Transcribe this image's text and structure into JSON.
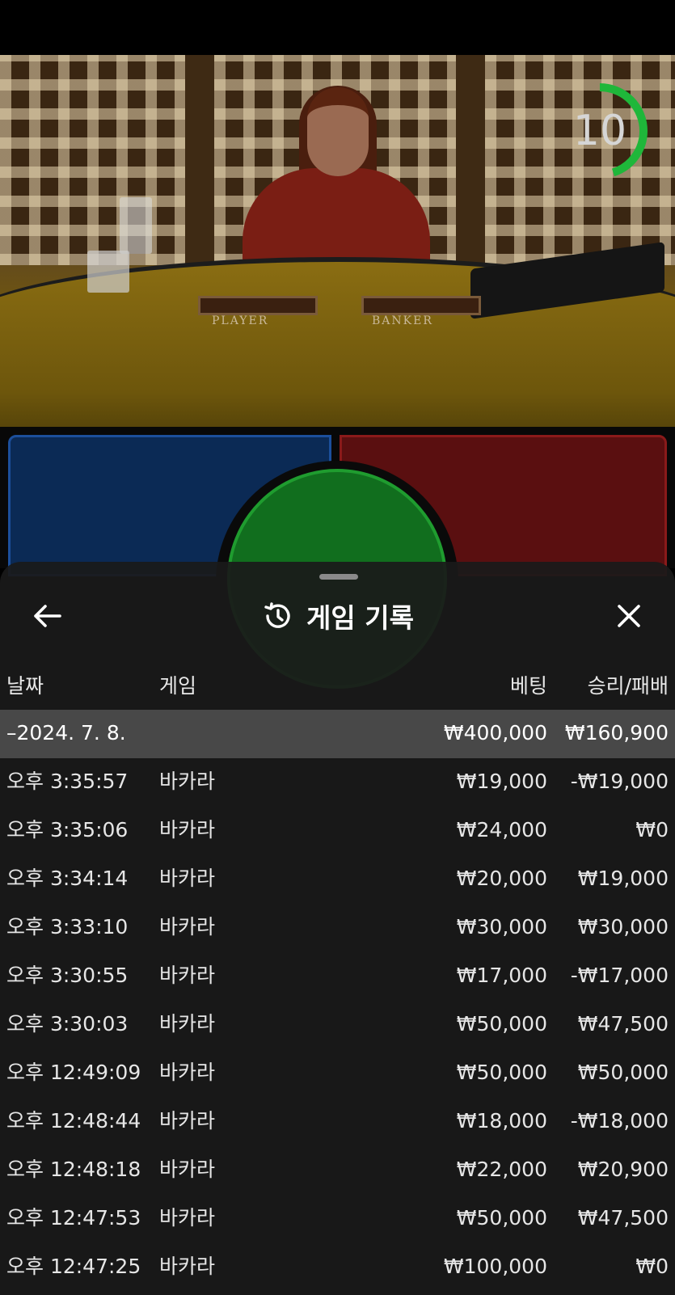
{
  "timer": {
    "value": "10",
    "progress": 0.45,
    "color": "#1fb73a"
  },
  "table": {
    "player_label": "PLAYER",
    "banker_label": "BANKER"
  },
  "sheet": {
    "title": "게임 기록",
    "back_icon": "arrow-left-icon",
    "history_icon": "history-icon",
    "close_icon": "close-icon"
  },
  "columns": {
    "date": "날짜",
    "game": "게임",
    "bet": "베팅",
    "win_loss": "승리/패배"
  },
  "summary": {
    "date": "–2024. 7. 8.",
    "bet": "₩400,000",
    "win_loss": "₩160,900"
  },
  "rows": [
    {
      "time": "오후 3:35:57",
      "game": "바카라",
      "bet": "₩19,000",
      "win_loss": "-₩19,000"
    },
    {
      "time": "오후 3:35:06",
      "game": "바카라",
      "bet": "₩24,000",
      "win_loss": "₩0"
    },
    {
      "time": "오후 3:34:14",
      "game": "바카라",
      "bet": "₩20,000",
      "win_loss": "₩19,000"
    },
    {
      "time": "오후 3:33:10",
      "game": "바카라",
      "bet": "₩30,000",
      "win_loss": "₩30,000"
    },
    {
      "time": "오후 3:30:55",
      "game": "바카라",
      "bet": "₩17,000",
      "win_loss": "-₩17,000"
    },
    {
      "time": "오후 3:30:03",
      "game": "바카라",
      "bet": "₩50,000",
      "win_loss": "₩47,500"
    },
    {
      "time": "오후 12:49:09",
      "game": "바카라",
      "bet": "₩50,000",
      "win_loss": "₩50,000"
    },
    {
      "time": "오후 12:48:44",
      "game": "바카라",
      "bet": "₩18,000",
      "win_loss": "-₩18,000"
    },
    {
      "time": "오후 12:48:18",
      "game": "바카라",
      "bet": "₩22,000",
      "win_loss": "₩20,900"
    },
    {
      "time": "오후 12:47:53",
      "game": "바카라",
      "bet": "₩50,000",
      "win_loss": "₩47,500"
    },
    {
      "time": "오후 12:47:25",
      "game": "바카라",
      "bet": "₩100,000",
      "win_loss": "₩0"
    }
  ]
}
